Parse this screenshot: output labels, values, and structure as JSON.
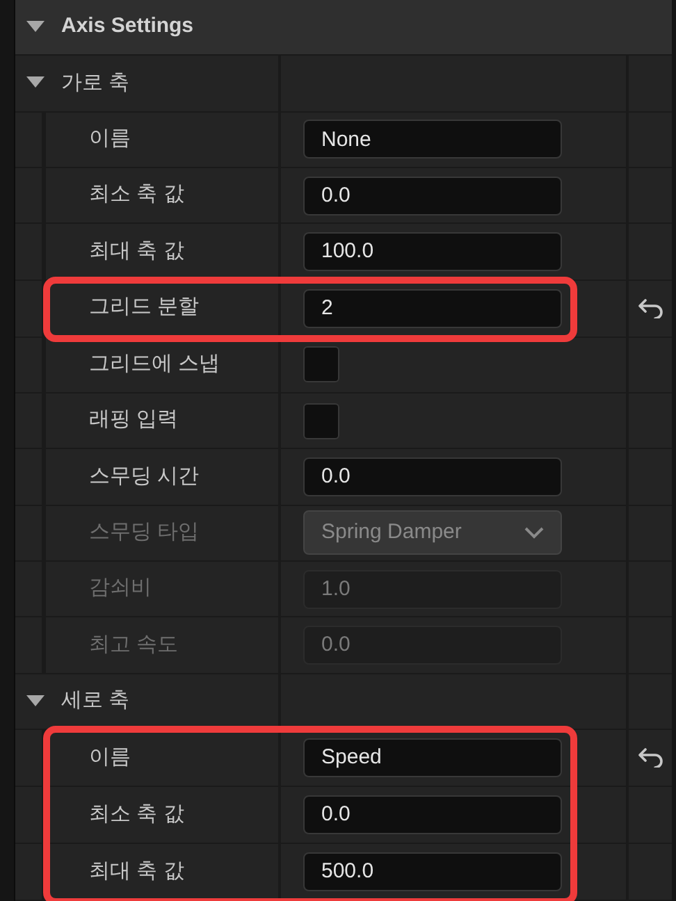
{
  "section": {
    "title": "Axis Settings",
    "expanded": true
  },
  "groups": [
    {
      "label": "가로 축",
      "expanded": true,
      "rows": [
        {
          "kind": "text",
          "label": "이름",
          "value": "None",
          "disabled": false,
          "reset": false,
          "highlighted": false
        },
        {
          "kind": "text",
          "label": "최소 축 값",
          "value": "0.0",
          "disabled": false,
          "reset": false,
          "highlighted": false
        },
        {
          "kind": "text",
          "label": "최대 축 값",
          "value": "100.0",
          "disabled": false,
          "reset": false,
          "highlighted": false
        },
        {
          "kind": "text",
          "label": "그리드 분할",
          "value": "2",
          "disabled": false,
          "reset": true,
          "highlighted": true
        },
        {
          "kind": "checkbox",
          "label": "그리드에 스냅",
          "checked": false,
          "disabled": false,
          "reset": false,
          "highlighted": false
        },
        {
          "kind": "checkbox",
          "label": "래핑 입력",
          "checked": false,
          "disabled": false,
          "reset": false,
          "highlighted": false
        },
        {
          "kind": "text",
          "label": "스무딩 시간",
          "value": "0.0",
          "disabled": false,
          "reset": false,
          "highlighted": false
        },
        {
          "kind": "dropdown",
          "label": "스무딩 타입",
          "value": "Spring Damper",
          "disabled": true,
          "reset": false,
          "highlighted": false
        },
        {
          "kind": "text",
          "label": "감쇠비",
          "value": "1.0",
          "disabled": true,
          "reset": false,
          "highlighted": false
        },
        {
          "kind": "text",
          "label": "최고 속도",
          "value": "0.0",
          "disabled": true,
          "reset": false,
          "highlighted": false
        }
      ]
    },
    {
      "label": "세로 축",
      "expanded": true,
      "rows": [
        {
          "kind": "text",
          "label": "이름",
          "value": "Speed",
          "disabled": false,
          "reset": true,
          "highlighted": true
        },
        {
          "kind": "text",
          "label": "최소 축 값",
          "value": "0.0",
          "disabled": false,
          "reset": false,
          "highlighted": true
        },
        {
          "kind": "text",
          "label": "최대 축 값",
          "value": "500.0",
          "disabled": false,
          "reset": false,
          "highlighted": true
        }
      ]
    }
  ]
}
